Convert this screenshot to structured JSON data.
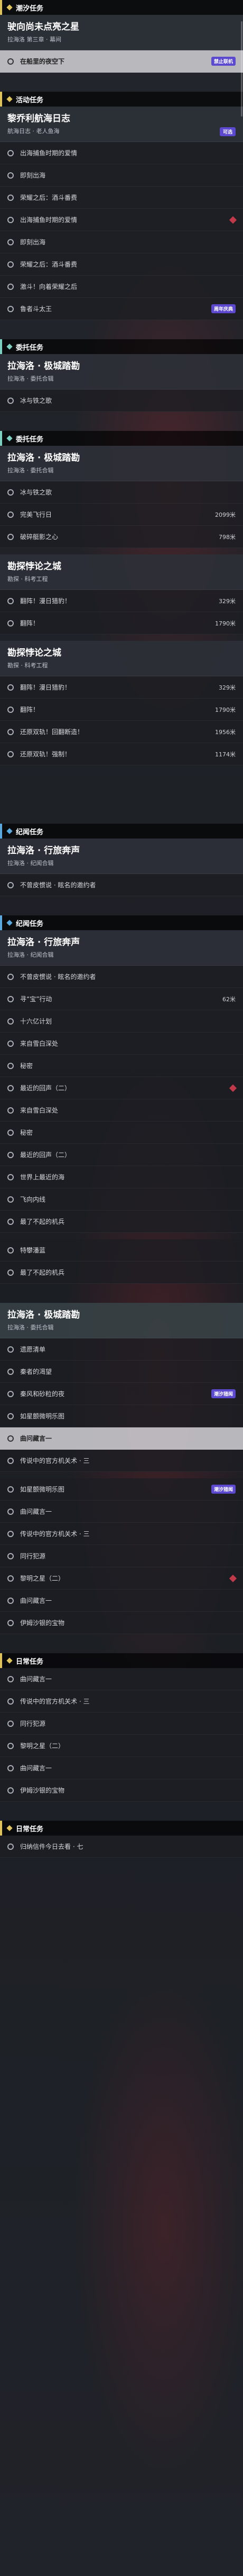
{
  "sections": [
    {
      "header": "潮汐任务",
      "accent": "#e0c25a",
      "cards": [
        {
          "title": "驶向尚未点亮之星",
          "subtitle": "拉海洛 第三章 · 幕间",
          "rows": [
            {
              "label": "在船里的夜空下",
              "highlight": true,
              "badge": "禁止联机"
            }
          ]
        }
      ]
    },
    {
      "header": "活动任务",
      "accent": "#e0c25a",
      "cards": [
        {
          "title": "黎乔利航海日志",
          "subtitle": "航海日志 · 老人鱼海",
          "badge": "可选",
          "rows": [
            {
              "label": "出海捕鱼时期的爱情"
            },
            {
              "label": "即刻出海"
            },
            {
              "label": "荣耀之后：酒斗番费"
            },
            {
              "label": "出海捕鱼时期的爱情",
              "marker": "red"
            },
            {
              "label": "即刻出海"
            },
            {
              "label": "荣耀之后：酒斗番费"
            },
            {
              "label": "激斗！向着荣耀之后"
            },
            {
              "label": "鲁者斗太王",
              "tag": "周年庆典"
            }
          ]
        }
      ]
    },
    {
      "header": "委托任务",
      "accent": "#7cd0c0",
      "cards": [
        {
          "title": "拉海洛 · 极城踏勘",
          "subtitle": "拉海洛 · 委托合辑",
          "rows": [
            {
              "label": "冰与铁之歌"
            }
          ]
        }
      ]
    },
    {
      "header": "委托任务",
      "accent": "#7cd0c0",
      "cards": [
        {
          "title": "拉海洛 · 极城踏勘",
          "subtitle": "拉海洛 · 委托合辑",
          "rows": [
            {
              "label": "冰与铁之歌"
            },
            {
              "label": "完美飞行日",
              "value": "2099米"
            },
            {
              "label": "破碎艇影之心",
              "value": "798米"
            }
          ]
        },
        {
          "title": "勘探悖论之城",
          "subtitle": "勘探 · 科考工程",
          "rows": [
            {
              "label": "翻阵！漫日猎豹！",
              "value": "329米"
            },
            {
              "label": "翻阵！",
              "value": "1790米"
            }
          ]
        },
        {
          "title": "勘探悖论之城",
          "subtitle": "勘探 · 科考工程",
          "rows": [
            {
              "label": "翻阵！漫日猎豹！",
              "value": "329米"
            },
            {
              "label": "翻阵！",
              "value": "1790米"
            },
            {
              "label": "还原双轨！回翻断造！",
              "value": "1956米"
            },
            {
              "label": "还原双轨！强制！",
              "value": "1174米"
            }
          ]
        }
      ]
    },
    {
      "header": "纪闻任务",
      "accent": "#5aa8e0",
      "cards": [
        {
          "title": "拉海洛 · 行旅奔声",
          "subtitle": "拉海洛 · 纪闻合辑",
          "rows": [
            {
              "label": "不曾皮惯说 · 眩名的邀约者"
            }
          ]
        }
      ]
    },
    {
      "header": "纪闻任务",
      "accent": "#5aa8e0",
      "cards": [
        {
          "title": "拉海洛 · 行旅奔声",
          "subtitle": "拉海洛 · 纪闻合辑",
          "rows": [
            {
              "label": "不曾皮惯说 · 眩名的邀约者"
            },
            {
              "label": "寻“宝”行动",
              "value": "62米"
            },
            {
              "label": "十六亿计划"
            },
            {
              "label": "来自雪白深处"
            },
            {
              "label": "秘密"
            },
            {
              "label": "最近的回声（二）",
              "marker": "red"
            },
            {
              "label": "来自雪白深处"
            },
            {
              "label": "秘密"
            },
            {
              "label": "最近的回声（二）"
            },
            {
              "label": "世界上最近的海"
            },
            {
              "label": "飞向内线"
            },
            {
              "label": "最了不起的机兵"
            }
          ]
        },
        {
          "title": "",
          "subtitle": "",
          "rows": [
            {
              "label": "特攀潘蓝"
            },
            {
              "label": "最了不起的机兵"
            }
          ]
        }
      ]
    },
    {
      "header": "",
      "accent": "#7cd0c0",
      "cards": [
        {
          "title": "拉海洛 · 极城踏勘",
          "subtitle": "拉海洛 · 委托合辑",
          "tinted": true,
          "rows": [
            {
              "label": "遗愿清单"
            },
            {
              "label": "秦者的渴望"
            },
            {
              "label": "秦风和砂粒的夜",
              "tag": "潮汐猎闻"
            },
            {
              "label": "如星颤微明乐图"
            },
            {
              "label": "曲问藏言一",
              "highlight": true
            },
            {
              "label": "传说中的官方机关术 · 三"
            }
          ]
        },
        {
          "title": "",
          "subtitle": "",
          "rows": [
            {
              "label": "如星颤微明乐图",
              "tag": "潮汐猎闻"
            },
            {
              "label": "曲问藏言一"
            },
            {
              "label": "传说中的官方机关术 · 三"
            },
            {
              "label": "同行犯源"
            },
            {
              "label": "黎明之星（二）",
              "marker": "red"
            },
            {
              "label": "曲问藏言一"
            },
            {
              "label": "伊姆沙银的宝物"
            }
          ]
        }
      ]
    },
    {
      "header": "日常任务",
      "accent": "#e0c25a",
      "cards": [
        {
          "title": "",
          "subtitle": "",
          "rows": [
            {
              "label": "曲问藏言一"
            },
            {
              "label": "传说中的官方机关术 · 三"
            },
            {
              "label": "同行犯源"
            },
            {
              "label": "黎明之星（二）"
            },
            {
              "label": "曲问藏言一"
            },
            {
              "label": "伊姆沙银的宝物"
            }
          ]
        }
      ]
    },
    {
      "header": "日常任务",
      "accent": "#e0c25a",
      "cards": [
        {
          "title": "",
          "subtitle": "",
          "rows": [
            {
              "label": "归纳信件今日去看 · 七"
            }
          ]
        }
      ]
    }
  ]
}
